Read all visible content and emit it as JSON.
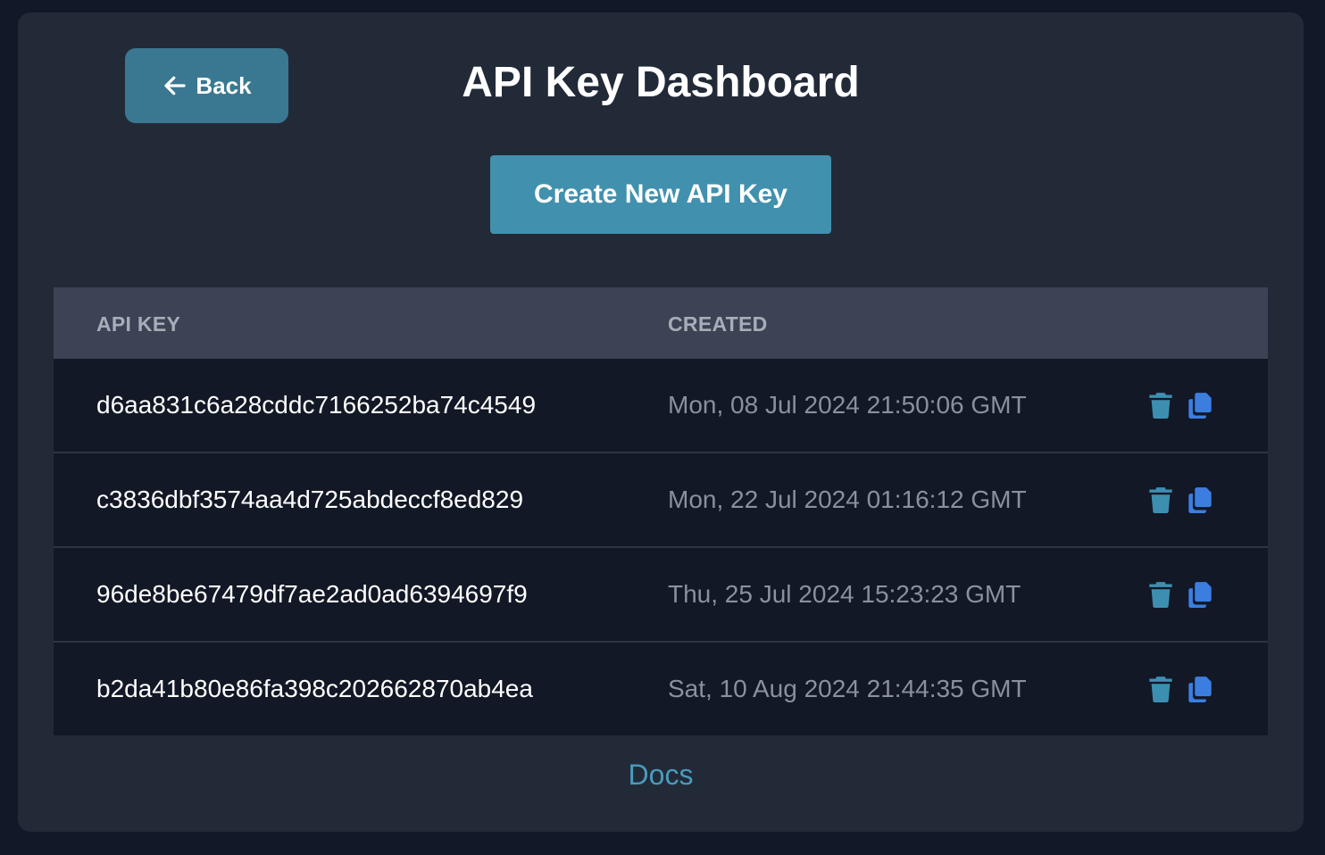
{
  "header": {
    "back_label": "Back",
    "title": "API Key Dashboard"
  },
  "actions": {
    "create_label": "Create New API Key"
  },
  "table": {
    "columns": [
      "API KEY",
      "CREATED"
    ],
    "rows": [
      {
        "key": "d6aa831c6a28cddc7166252ba74c4549",
        "created": "Mon, 08 Jul 2024 21:50:06 GMT"
      },
      {
        "key": "c3836dbf3574aa4d725abdeccf8ed829",
        "created": "Mon, 22 Jul 2024 01:16:12 GMT"
      },
      {
        "key": "96de8be67479df7ae2ad0ad6394697f9",
        "created": "Thu, 25 Jul 2024 15:23:23 GMT"
      },
      {
        "key": "b2da41b80e86fa398c202662870ab4ea",
        "created": "Sat, 10 Aug 2024 21:44:35 GMT"
      }
    ],
    "row_icons": [
      "trash-icon",
      "copy-icon"
    ]
  },
  "footer": {
    "docs_label": "Docs"
  },
  "colors": {
    "background": "#111827",
    "panel": "#222a38",
    "back_button": "#3a7891",
    "create_button": "#4191ae",
    "table_header": "#3b4354",
    "row": "#121826",
    "trash_icon": "#3d8fb1",
    "copy_icon": "#3b7ee0",
    "docs_link": "#4a9bbb"
  }
}
